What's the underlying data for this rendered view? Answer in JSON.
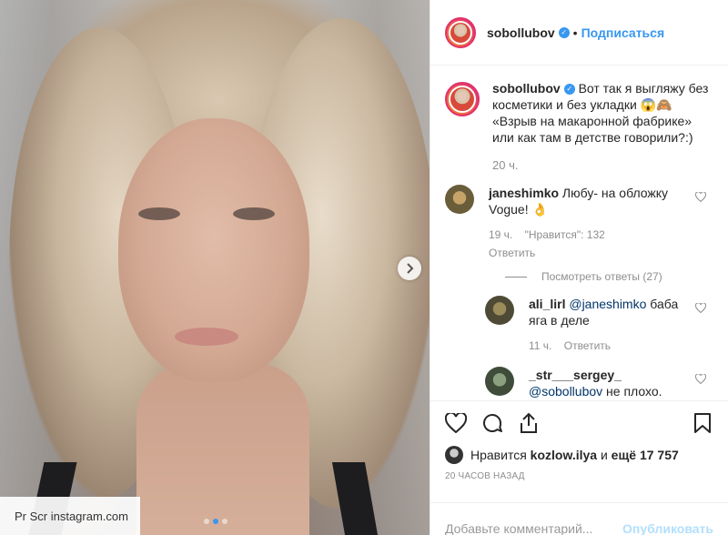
{
  "post": {
    "username": "sobollubov",
    "follow_label": "Подписаться",
    "separator": "•",
    "caption_text": "Вот так я выгляжу без косметики и без укладки 😱🙈 «Взрыв на макаронной фабрике» или как там в детстве говорили?:)",
    "caption_time": "20 ч."
  },
  "comments": [
    {
      "user": "janeshimko",
      "text": "Любу- на обложку Vogue! 👌",
      "time": "19 ч.",
      "likes": "\"Нравится\": 132",
      "reply": "Ответить",
      "view_replies": "Посмотреть ответы (27)"
    }
  ],
  "replies": [
    {
      "user": "ali_lirl",
      "mention": "@janeshimko",
      "text": " баба яга в деле",
      "time": "11 ч.",
      "reply": "Ответить"
    },
    {
      "user": "_str___sergey_",
      "mention": "@sobollubov",
      "text": " не плохо."
    }
  ],
  "likes": {
    "prefix": "Нравится ",
    "user": "kozlow.ilya",
    "middle": " и ",
    "count": "ещё 17 757"
  },
  "ago": "20 ЧАСОВ НАЗАД",
  "comment_input": {
    "placeholder": "Добавьте комментарий...",
    "publish": "Опубликовать"
  },
  "photo": {
    "watermark": "Pr Scr instagram.com",
    "carousel_count": 3,
    "active_dot": 1
  },
  "colors": {
    "accent": "#3897f0",
    "publish_disabled": "#b2dffc",
    "muted": "#8e8e8e"
  },
  "icons": [
    "verified-badge-icon",
    "chevron-right-icon",
    "heart-icon",
    "comment-icon",
    "share-icon",
    "bookmark-icon"
  ]
}
